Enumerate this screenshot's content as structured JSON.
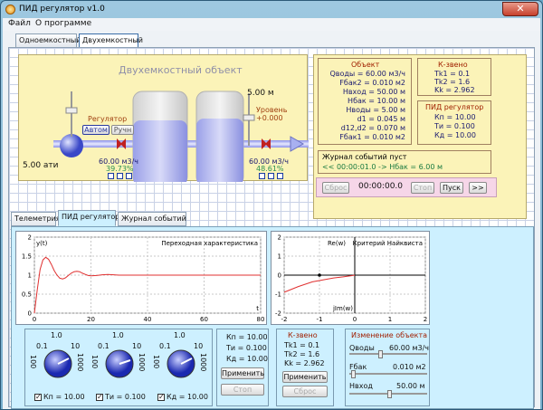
{
  "window": {
    "title": "ПИД регулятор v1.0",
    "close": "✕"
  },
  "menu": [
    "Файл",
    "О программе"
  ],
  "top_tabs": [
    "Одноемкостный",
    "Двухемкостный"
  ],
  "plant": {
    "title": "Двухемкостный объект",
    "regulator_label": "Регулятор",
    "mode_auto": "Автом",
    "mode_manual": "Ручн",
    "level_value": "5.00 м",
    "level_label": "Уровень",
    "level_delta": "+0.000",
    "pressure": "5.00 ати",
    "flow_left": "60.00 м3/ч",
    "pct_left": "39.73%",
    "flow_right": "60.00 м3/ч",
    "pct_right": "48.61%"
  },
  "object_panel": {
    "title": "Объект",
    "rows": [
      "Qводы = 60.00 м3/ч",
      "Fбак2 = 0.010 м2",
      "Hвход = 50.00 м",
      "Hбак = 10.00 м",
      "Hводы = 5.00 м",
      "d1 = 0.045 м",
      "d12,d2 = 0.070 м",
      "Fбак1 = 0.010 м2"
    ]
  },
  "k_panel": {
    "title": "К-звено",
    "rows": [
      "Tk1 = 0.1",
      "Tk2 = 1.6",
      "Kk = 2.962"
    ]
  },
  "pid_panel": {
    "title": "ПИД регулятор",
    "rows": [
      "Кп = 10.00",
      "Ти = 0.100",
      "Кд = 10.00"
    ]
  },
  "events": {
    "status": "Журнал событий пуст",
    "line": "<<  00:00:01.0 -> Hбак = 6.00 м",
    "reset": "Сброс",
    "time": "00:00:00.0",
    "stop": "Стоп",
    "start": "Пуск",
    "fast": ">>"
  },
  "tabs": [
    "Телеметрия",
    "ПИД регулятор",
    "Журнал событий"
  ],
  "chart1": {
    "title": "Переходная характеристика",
    "ylabel": "y(t)",
    "xlabel": "t"
  },
  "chart2": {
    "title": "Критерий Найквиста",
    "ylabel": "Re(w)",
    "xlabel": "jIm(w)"
  },
  "knobs": [
    {
      "check": "Кп = 10.00",
      "scale": [
        "1.0",
        "0.1",
        "10",
        "100",
        "1000"
      ]
    },
    {
      "check": "Ти = 0.100",
      "scale": [
        "1.0",
        "0.1",
        "10",
        "100",
        "1000"
      ]
    },
    {
      "check": "Кд = 10.00",
      "scale": [
        "1.0",
        "0.1",
        "10",
        "100",
        "1000"
      ]
    }
  ],
  "pid_box": {
    "rows": [
      "Кп = 10.00",
      "Ти = 0.100",
      "Кд = 10.00"
    ],
    "apply": "Применить",
    "stop": "Стоп"
  },
  "k_box": {
    "title": "К-звено",
    "rows": [
      "Tk1 = 0.1",
      "Tk2 = 1.6",
      "Kk = 2.962"
    ],
    "apply": "Применить",
    "reset": "Сброс"
  },
  "change_box": {
    "title": "Изменение объекта",
    "items": [
      {
        "label": "Qводы",
        "value": "60.00 м3/ч"
      },
      {
        "label": "Fбак",
        "value": "0.010 м2"
      },
      {
        "label": "Hвход",
        "value": "50.00 м"
      }
    ]
  },
  "chart_data": [
    {
      "type": "line",
      "title": "Переходная характеристика",
      "ylabel": "y(t)",
      "xlabel": "t",
      "xlim": [
        0,
        80
      ],
      "ylim": [
        0,
        2
      ],
      "xticks": [
        0,
        20,
        40,
        60,
        80
      ],
      "yticks": [
        0,
        0.5,
        1,
        1.5,
        2
      ],
      "grid": true,
      "series": [
        {
          "x": [
            0,
            1,
            2,
            3,
            4,
            5,
            6,
            7,
            8,
            9,
            10,
            11,
            12,
            13,
            14,
            15,
            16,
            17,
            18,
            19,
            20,
            22,
            24,
            26,
            28,
            30,
            32,
            34,
            36,
            38,
            40,
            45,
            50,
            55,
            60,
            70,
            80
          ],
          "y": [
            0,
            0.6,
            1.15,
            1.4,
            1.47,
            1.42,
            1.28,
            1.12,
            1.0,
            0.92,
            0.9,
            0.93,
            0.99,
            1.05,
            1.09,
            1.1,
            1.09,
            1.05,
            1.02,
            0.99,
            0.98,
            0.99,
            1.01,
            1.02,
            1.01,
            1.0,
            1.0,
            1.0,
            1.0,
            1.0,
            1.0,
            1.0,
            1.0,
            1.0,
            1.0,
            1.0,
            1.0
          ],
          "color": "#e03030"
        }
      ]
    },
    {
      "type": "line",
      "title": "Критерий Найквиста",
      "ylabel": "Re(w)",
      "xlabel": "jIm(w)",
      "xlim": [
        -2,
        2
      ],
      "ylim": [
        -2,
        2
      ],
      "xticks": [
        -2,
        -1,
        0,
        1,
        2
      ],
      "yticks": [
        -2,
        -1,
        0,
        1,
        2
      ],
      "grid": true,
      "marker": [
        -1,
        0
      ],
      "series": [
        {
          "x": [
            -2,
            -1.6,
            -1.2,
            -0.9,
            -0.6,
            -0.3,
            -0.1,
            0
          ],
          "y": [
            -0.9,
            -0.6,
            -0.35,
            -0.25,
            -0.15,
            -0.08,
            -0.03,
            0
          ],
          "color": "#e03030"
        }
      ]
    }
  ]
}
